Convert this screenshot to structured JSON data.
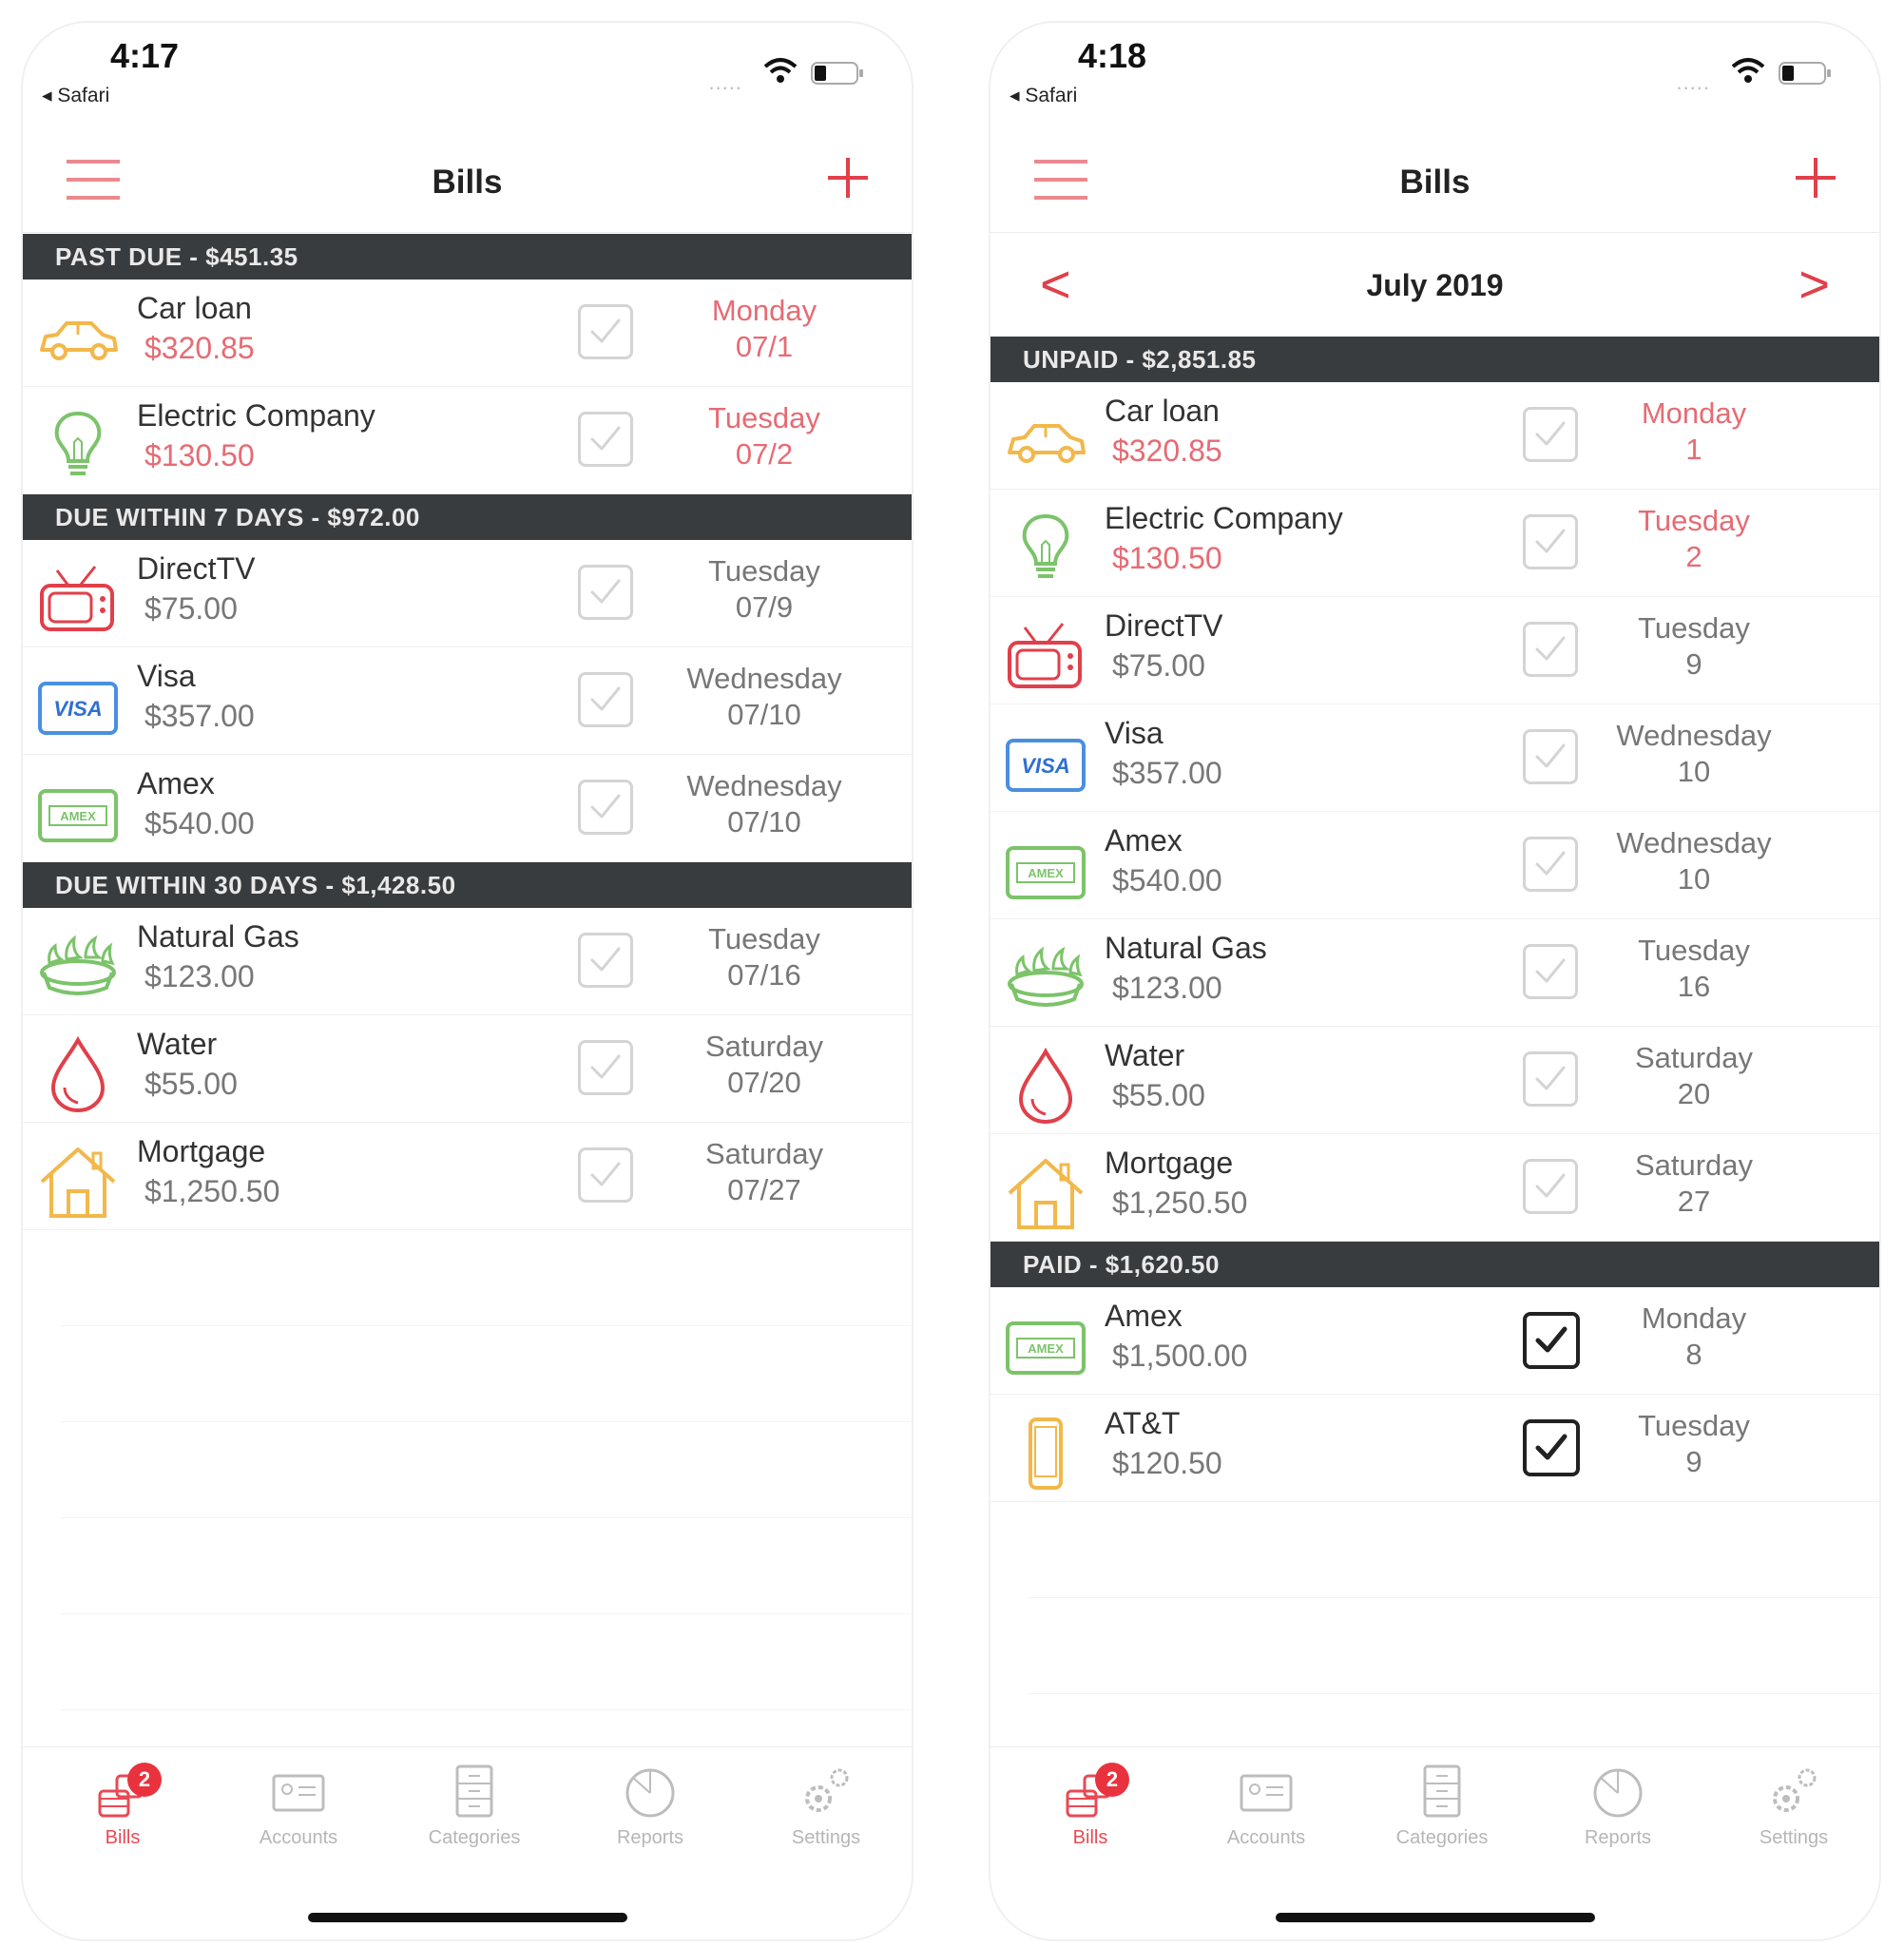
{
  "colors": {
    "accent": "#e0404a",
    "header_bg": "#393c3f",
    "overdue": "#e66b74"
  },
  "screens": [
    {
      "status": {
        "time": "4:17",
        "back_label": "◂ Safari",
        "signal": "....."
      },
      "nav": {
        "title": "Bills"
      },
      "sections": [
        {
          "header": "PAST DUE - $451.35",
          "rows": [
            {
              "icon": "car-icon",
              "name": "Car loan",
              "amount": "$320.85",
              "day": "Monday",
              "date": "07/1",
              "overdue": true,
              "paid": false
            },
            {
              "icon": "lightbulb-icon",
              "name": "Electric Company",
              "amount": "$130.50",
              "day": "Tuesday",
              "date": "07/2",
              "overdue": true,
              "paid": false
            }
          ]
        },
        {
          "header": "DUE WITHIN 7 DAYS - $972.00",
          "rows": [
            {
              "icon": "tv-icon",
              "name": "DirectTV",
              "amount": "$75.00",
              "day": "Tuesday",
              "date": "07/9",
              "overdue": false,
              "paid": false
            },
            {
              "icon": "visa-card-icon",
              "name": "Visa",
              "amount": "$357.00",
              "day": "Wednesday",
              "date": "07/10",
              "overdue": false,
              "paid": false
            },
            {
              "icon": "amex-card-icon",
              "name": "Amex",
              "amount": "$540.00",
              "day": "Wednesday",
              "date": "07/10",
              "overdue": false,
              "paid": false
            }
          ]
        },
        {
          "header": "DUE WITHIN 30 DAYS - $1,428.50",
          "rows": [
            {
              "icon": "gas-burner-icon",
              "name": "Natural Gas",
              "amount": "$123.00",
              "day": "Tuesday",
              "date": "07/16",
              "overdue": false,
              "paid": false
            },
            {
              "icon": "water-drop-icon",
              "name": "Water",
              "amount": "$55.00",
              "day": "Saturday",
              "date": "07/20",
              "overdue": false,
              "paid": false
            },
            {
              "icon": "house-icon",
              "name": "Mortgage",
              "amount": "$1,250.50",
              "day": "Saturday",
              "date": "07/27",
              "overdue": false,
              "paid": false
            }
          ]
        }
      ],
      "tabs": [
        {
          "label": "Bills",
          "icon": "bills-icon",
          "active": true,
          "badge": "2"
        },
        {
          "label": "Accounts",
          "icon": "accounts-icon",
          "active": false
        },
        {
          "label": "Categories",
          "icon": "categories-icon",
          "active": false
        },
        {
          "label": "Reports",
          "icon": "reports-icon",
          "active": false
        },
        {
          "label": "Settings",
          "icon": "settings-icon",
          "active": false
        }
      ]
    },
    {
      "status": {
        "time": "4:18",
        "back_label": "◂ Safari",
        "signal": "....."
      },
      "nav": {
        "title": "Bills"
      },
      "month": {
        "label": "July 2019",
        "prev": "<",
        "next": ">"
      },
      "sections": [
        {
          "header": "UNPAID - $2,851.85",
          "rows": [
            {
              "icon": "car-icon",
              "name": "Car loan",
              "amount": "$320.85",
              "day": "Monday",
              "date": "1",
              "overdue": true,
              "paid": false
            },
            {
              "icon": "lightbulb-icon",
              "name": "Electric Company",
              "amount": "$130.50",
              "day": "Tuesday",
              "date": "2",
              "overdue": true,
              "paid": false
            },
            {
              "icon": "tv-icon",
              "name": "DirectTV",
              "amount": "$75.00",
              "day": "Tuesday",
              "date": "9",
              "overdue": false,
              "paid": false
            },
            {
              "icon": "visa-card-icon",
              "name": "Visa",
              "amount": "$357.00",
              "day": "Wednesday",
              "date": "10",
              "overdue": false,
              "paid": false
            },
            {
              "icon": "amex-card-icon",
              "name": "Amex",
              "amount": "$540.00",
              "day": "Wednesday",
              "date": "10",
              "overdue": false,
              "paid": false
            },
            {
              "icon": "gas-burner-icon",
              "name": "Natural Gas",
              "amount": "$123.00",
              "day": "Tuesday",
              "date": "16",
              "overdue": false,
              "paid": false
            },
            {
              "icon": "water-drop-icon",
              "name": "Water",
              "amount": "$55.00",
              "day": "Saturday",
              "date": "20",
              "overdue": false,
              "paid": false
            },
            {
              "icon": "house-icon",
              "name": "Mortgage",
              "amount": "$1,250.50",
              "day": "Saturday",
              "date": "27",
              "overdue": false,
              "paid": false
            }
          ]
        },
        {
          "header": "PAID - $1,620.50",
          "rows": [
            {
              "icon": "amex-card-icon",
              "name": "Amex",
              "amount": "$1,500.00",
              "day": "Monday",
              "date": "8",
              "overdue": false,
              "paid": true
            },
            {
              "icon": "phone-icon",
              "name": "AT&T",
              "amount": "$120.50",
              "day": "Tuesday",
              "date": "9",
              "overdue": false,
              "paid": true
            }
          ]
        }
      ],
      "tabs": [
        {
          "label": "Bills",
          "icon": "bills-icon",
          "active": true,
          "badge": "2"
        },
        {
          "label": "Accounts",
          "icon": "accounts-icon",
          "active": false
        },
        {
          "label": "Categories",
          "icon": "categories-icon",
          "active": false
        },
        {
          "label": "Reports",
          "icon": "reports-icon",
          "active": false
        },
        {
          "label": "Settings",
          "icon": "settings-icon",
          "active": false
        }
      ]
    }
  ]
}
